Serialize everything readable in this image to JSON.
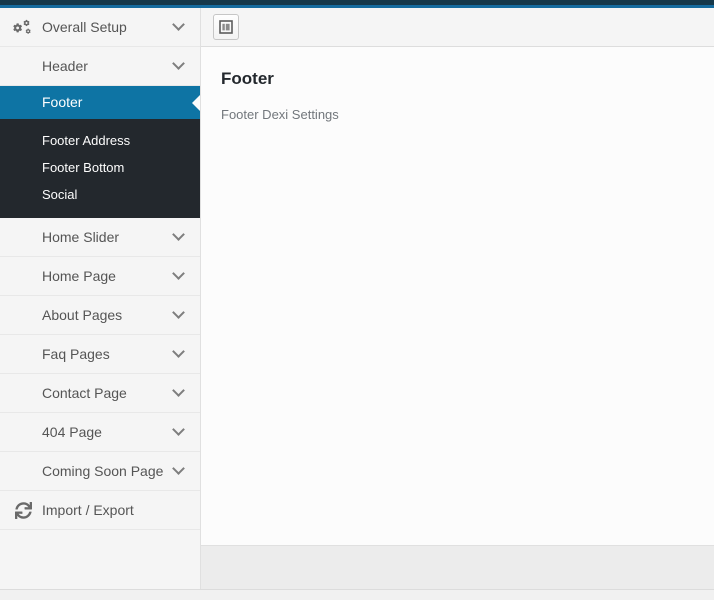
{
  "colors": {
    "topbar_dark": "#16384a",
    "topbar_blue": "#166b9e",
    "active_item_bg": "#0e74a4",
    "submenu_bg": "#23282d",
    "sidebar_bg": "#f5f5f5",
    "content_bg": "#fcfcfc"
  },
  "sidebar": {
    "items": [
      {
        "label": "Overall Setup",
        "icon": "gears-icon",
        "chevron": true
      },
      {
        "label": "Header",
        "chevron": true
      },
      {
        "label": "Footer",
        "active": true
      },
      {
        "label": "Footer Address",
        "sub": true
      },
      {
        "label": "Footer Bottom",
        "sub": true
      },
      {
        "label": "Social",
        "sub": true
      },
      {
        "label": "Home Slider",
        "chevron": true
      },
      {
        "label": "Home Page",
        "chevron": true
      },
      {
        "label": "About Pages",
        "chevron": true
      },
      {
        "label": "Faq Pages",
        "chevron": true
      },
      {
        "label": "Contact Page",
        "chevron": true
      },
      {
        "label": "404 Page",
        "chevron": true
      },
      {
        "label": "Coming Soon Page",
        "chevron": true
      },
      {
        "label": "Import / Export",
        "icon": "refresh-icon"
      }
    ]
  },
  "content": {
    "toolbar": {
      "expand_button": "expand-layout-icon"
    },
    "title": "Footer",
    "subtitle": "Footer Dexi Settings"
  }
}
